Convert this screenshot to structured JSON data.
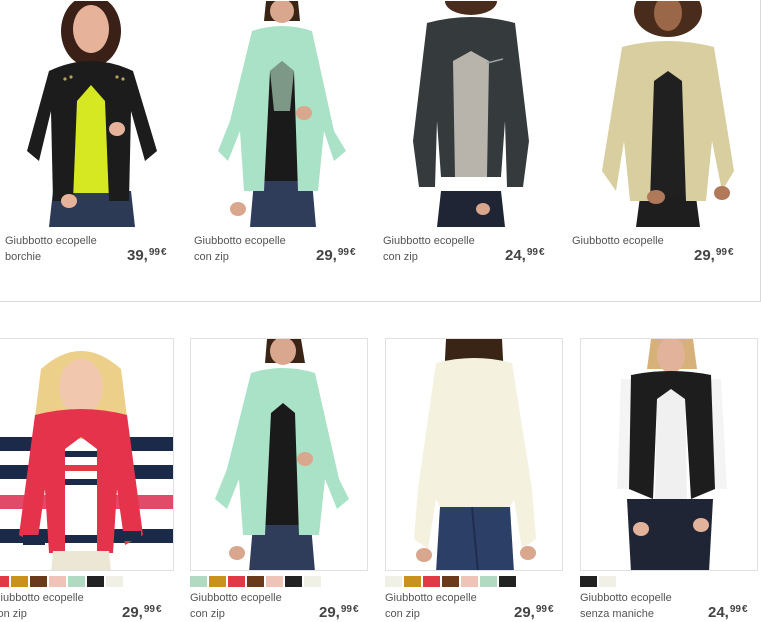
{
  "products_top": [
    {
      "name_line1": "Giubbotto ecopelle",
      "name_line2": "borchie",
      "price_int": "39,",
      "price_cents": "99",
      "currency": "€",
      "image": "black-studded-leather-jacket-yellow-top"
    },
    {
      "name_line1": "Giubbotto ecopelle",
      "name_line2": "con zip",
      "price_int": "29,",
      "price_cents": "99",
      "currency": "€",
      "image": "mint-leather-jacket"
    },
    {
      "name_line1": "Giubbotto ecopelle",
      "name_line2": "con zip",
      "price_int": "24,",
      "price_cents": "99",
      "currency": "€",
      "image": "dark-grey-leather-jacket"
    },
    {
      "name_line1": "Giubbotto ecopelle",
      "name_line2": "",
      "price_int": "29,",
      "price_cents": "99",
      "currency": "€",
      "image": "beige-leather-jacket"
    }
  ],
  "products_bottom": [
    {
      "name_line1": "Giubbotto ecopelle",
      "name_line2": "con zip",
      "price_int": "29,",
      "price_cents": "99",
      "currency": "€",
      "image": "red-leather-jacket-striped-background",
      "swatches": [
        "#e23a45",
        "#c8921d",
        "#6b3a1a",
        "#efc3b7",
        "#b2d9c2",
        "#222222",
        "#f1f0e6"
      ]
    },
    {
      "name_line1": "Giubbotto ecopelle",
      "name_line2": "con zip",
      "price_int": "29,",
      "price_cents": "99",
      "currency": "€",
      "image": "mint-leather-jacket",
      "swatches": [
        "#b2d9c2",
        "#c8921d",
        "#e23a45",
        "#6b3a1a",
        "#efc3b7",
        "#222222",
        "#f1f0e6"
      ]
    },
    {
      "name_line1": "Giubbotto ecopelle",
      "name_line2": "con zip",
      "price_int": "29,",
      "price_cents": "99",
      "currency": "€",
      "image": "cream-leather-jacket-back",
      "swatches": [
        "#f1f0e6",
        "#c8921d",
        "#e23a45",
        "#6b3a1a",
        "#efc3b7",
        "#b2d9c2",
        "#222222"
      ]
    },
    {
      "name_line1": "Giubbotto ecopelle",
      "name_line2": "senza maniche",
      "price_int": "24,",
      "price_cents": "99",
      "currency": "€",
      "image": "black-leather-vest",
      "swatches": [
        "#222222",
        "#f1f0e6"
      ]
    }
  ]
}
